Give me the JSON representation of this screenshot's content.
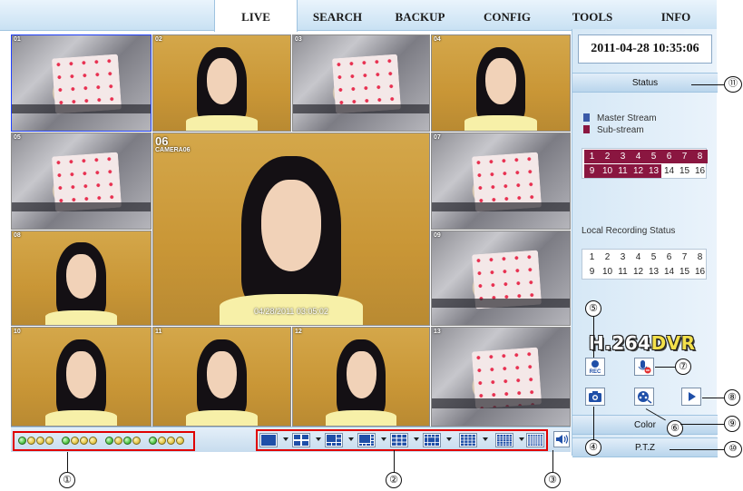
{
  "tabs": [
    {
      "label": "LIVE",
      "active": true
    },
    {
      "label": "SEARCH"
    },
    {
      "label": "BACKUP"
    },
    {
      "label": "CONFIG"
    },
    {
      "label": "TOOLS"
    },
    {
      "label": "INFO"
    }
  ],
  "cameras": {
    "c1": {
      "id": "01"
    },
    "c2": {
      "id": "02"
    },
    "c3": {
      "id": "03"
    },
    "c4": {
      "id": "04"
    },
    "c5": {
      "id": "05"
    },
    "c6": {
      "id": "06",
      "name": "CAMERA06",
      "timestamp": "04/28/2011 03:05:02"
    },
    "c7": {
      "id": "07"
    },
    "c8": {
      "id": "08"
    },
    "c9": {
      "id": "09"
    },
    "c10": {
      "id": "10"
    },
    "c11": {
      "id": "11"
    },
    "c12": {
      "id": "12"
    },
    "c13": {
      "id": "13"
    }
  },
  "clock": "2011-04-28 10:35:06",
  "status_button": "Status",
  "legend": {
    "master": "Master Stream",
    "sub": "Sub-stream"
  },
  "stream_channels": [
    "1",
    "2",
    "3",
    "4",
    "5",
    "6",
    "7",
    "8",
    "9",
    "10",
    "11",
    "12",
    "13",
    "14",
    "15",
    "16"
  ],
  "stream_channels_active": 13,
  "local_recording_label": "Local Recording Status",
  "recording_channels": [
    "1",
    "2",
    "3",
    "4",
    "5",
    "6",
    "7",
    "8",
    "9",
    "10",
    "11",
    "12",
    "13",
    "14",
    "15",
    "16"
  ],
  "logo": {
    "codec": "H.264",
    "brand": "DVR"
  },
  "buttons": {
    "rec": "REC",
    "color": "Color",
    "ptz": "P.T.Z"
  },
  "markers": {
    "m1": "①",
    "m2": "②",
    "m3": "③",
    "m4": "④",
    "m5": "⑤",
    "m6": "⑥",
    "m7": "⑦",
    "m8": "⑧",
    "m9": "⑨",
    "m10": "⑩",
    "m11": "⑪"
  },
  "colors": {
    "accent_border": "#e00000",
    "channel_active": "#8a1640",
    "master_stream": "#3a5aa8",
    "led_green": "#52c646",
    "led_yellow": "#e5c84a"
  }
}
